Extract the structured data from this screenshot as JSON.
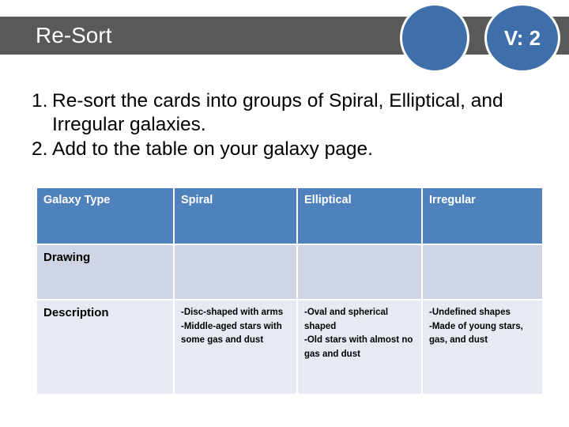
{
  "header": {
    "title": "Re-Sort",
    "version_badge": "V: 2",
    "banner_color": "#595959",
    "circle_color": "#3F6FAB"
  },
  "instructions": [
    "Re-sort the cards into groups of Spiral, Elliptical, and Irregular galaxies.",
    "Add to the table on your galaxy page."
  ],
  "table": {
    "header_color": "#4F81BD",
    "drawing_row_color": "#CFD5E4",
    "description_row_color": "#E6EAF2",
    "columns": [
      "Galaxy Type",
      "Spiral",
      "Elliptical",
      "Irregular"
    ],
    "rows": [
      {
        "label": "Drawing",
        "spiral": "",
        "elliptical": "",
        "irregular": ""
      },
      {
        "label": "Description",
        "spiral": "-Disc-shaped with arms\n-Middle-aged stars with some gas and dust",
        "elliptical": "-Oval and spherical shaped\n-Old stars with almost no gas and dust",
        "irregular": "-Undefined shapes\n-Made of young stars, gas, and dust"
      }
    ]
  }
}
